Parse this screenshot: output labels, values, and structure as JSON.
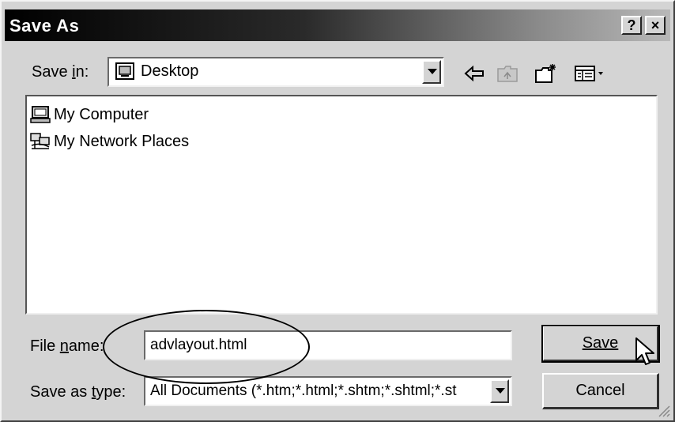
{
  "window": {
    "title": "Save As",
    "help_label": "?",
    "close_label": "×"
  },
  "toolbar": {
    "save_in_label": "Save in:",
    "location": "Desktop",
    "location_icon": "desktop-icon",
    "buttons": [
      "back-arrow-icon",
      "up-folder-icon",
      "new-folder-icon",
      "view-menu-icon"
    ]
  },
  "file_list": {
    "items": [
      {
        "label": "My Computer",
        "icon": "my-computer-icon"
      },
      {
        "label": "My Network Places",
        "icon": "network-places-icon"
      }
    ]
  },
  "form": {
    "file_name_label": "File name:",
    "file_name_value": "advlayout.html",
    "save_as_type_label": "Save as type:",
    "save_as_type_value": "All Documents (*.htm;*.html;*.shtm;*.shtml;*.st"
  },
  "actions": {
    "save_label": "Save",
    "cancel_label": "Cancel"
  }
}
